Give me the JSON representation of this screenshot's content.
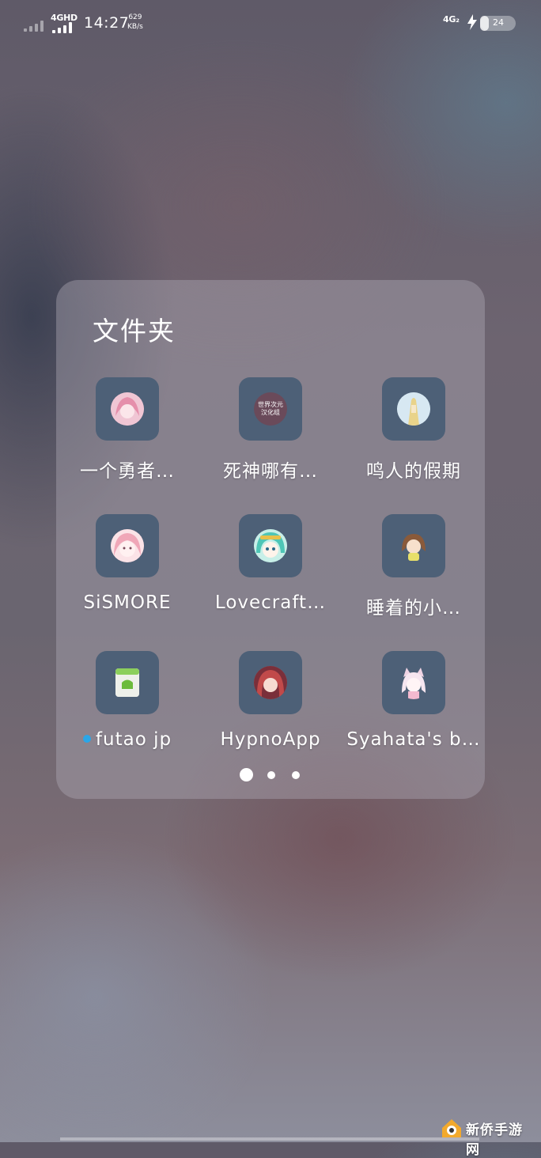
{
  "status_bar": {
    "network_1": "4GHD",
    "time": "14:27",
    "speed_value": "629",
    "speed_unit": "KB/s",
    "network_2": "4G₂",
    "battery": "24",
    "battery_level_percent": 24
  },
  "folder": {
    "title": "文件夹",
    "apps": [
      {
        "label": "一个勇者…",
        "icon": "pink-anime-girl-avatar",
        "color": "#e9b9c9"
      },
      {
        "label": "死神哪有…",
        "icon": "translation-group-logo-avatar",
        "color": "#6a4a5a",
        "badge_line_1": "世界次元",
        "badge_line_2": "汉化组"
      },
      {
        "label": "鸣人的假期",
        "icon": "blonde-character-avatar",
        "color": "#cfe3ef"
      },
      {
        "label": "SiSMORE",
        "icon": "pink-hair-girl-avatar",
        "color": "#f3c6cf"
      },
      {
        "label": "Lovecraft…",
        "icon": "cyan-hair-girl-avatar",
        "color": "#b6e8e0"
      },
      {
        "label": "睡着的小…",
        "icon": "brown-hair-girl-avatar",
        "color": "#5a6b82"
      },
      {
        "label": "futao jp",
        "icon": "android-apk-icon",
        "color": "#e8ebe4",
        "new": true
      },
      {
        "label": "HypnoApp",
        "icon": "red-hair-girl-avatar",
        "color": "#b04a4a"
      },
      {
        "label": "Syahata's b…",
        "icon": "white-hair-catgirl-avatar",
        "color": "#eadbe6"
      }
    ],
    "page_count": 3,
    "current_page": 1
  },
  "watermark": {
    "text": "新侨手游网"
  }
}
